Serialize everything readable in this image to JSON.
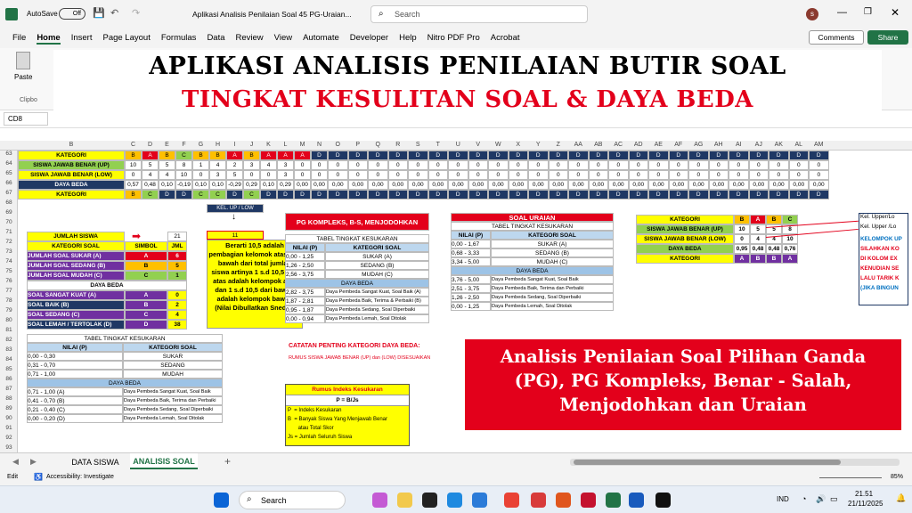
{
  "app": {
    "autosave": "AutoSave",
    "autosave_state": "Off",
    "title": "Aplikasi Analisis Penilaian Soal 45 PG-Uraian...",
    "search": "Search",
    "user_initial": "s"
  },
  "ribbon": {
    "tabs": [
      "File",
      "Home",
      "Insert",
      "Page Layout",
      "Formulas",
      "Data",
      "Review",
      "View",
      "Automate",
      "Developer",
      "Help",
      "Nitro PDF Pro",
      "Acrobat"
    ],
    "comments": "Comments",
    "share": "Share",
    "paste": "Paste",
    "clipboard": "Clipbo"
  },
  "namebox": "CD8",
  "overlay": {
    "line1": "APLIKASI ANALISIS PENILAIAN BUTIR SOAL",
    "line2": "TINGKAT KESULITAN SOAL & DAYA BEDA"
  },
  "columns": [
    "B",
    "C",
    "D",
    "E",
    "F",
    "G",
    "H",
    "I",
    "J",
    "K",
    "L",
    "M",
    "N",
    "O",
    "P",
    "Q",
    "R",
    "S",
    "T",
    "U",
    "V",
    "W",
    "X",
    "Y",
    "Z",
    "AA",
    "AB",
    "AC",
    "AD",
    "AE",
    "AF",
    "AG",
    "AH",
    "AI",
    "AJ",
    "AK",
    "AL",
    "AM"
  ],
  "rows": [
    "63",
    "64",
    "65",
    "66",
    "67",
    "68",
    "69",
    "70",
    "71",
    "72",
    "73",
    "74",
    "75",
    "76",
    "77",
    "78",
    "79",
    "80",
    "81",
    "82",
    "83",
    "84",
    "85",
    "86",
    "87",
    "88",
    "89",
    "90",
    "91",
    "92",
    "93"
  ],
  "toprows": {
    "r63": {
      "label": "KATEGORI",
      "vals": [
        "B",
        "A",
        "B",
        "C",
        "B",
        "B",
        "A",
        "B",
        "A",
        "A",
        "A"
      ]
    },
    "r64": {
      "label": "SISWA JAWAB BENAR (UP)",
      "vals": [
        "10",
        "5",
        "5",
        "8",
        "1",
        "4",
        "2",
        "3",
        "4",
        "3",
        "0"
      ]
    },
    "r65": {
      "label": "SISWA JAWAB BENAR (LOW)",
      "vals": [
        "0",
        "4",
        "4",
        "10",
        "0",
        "3",
        "5",
        "0",
        "0",
        "3",
        "0"
      ]
    },
    "r66": {
      "label": "DAYA BEDA",
      "vals": [
        "0,57",
        "0,48",
        "0,10",
        "-0,19",
        "0,10",
        "0,10",
        "-0,29",
        "0,29",
        "0,10",
        "0,29",
        "0,00"
      ]
    },
    "r67": {
      "label": "KATEGORI",
      "vals": [
        "B",
        "C",
        "D",
        "D",
        "C",
        "C",
        "D",
        "C",
        "D",
        "D",
        "D"
      ]
    },
    "zero": "0",
    "zero2": "0,00",
    "d": "D"
  },
  "kel": {
    "label": "KEL. UP / LOW",
    "value": "11"
  },
  "jumlah": {
    "label": "JUMLAH SISWA",
    "value": "21"
  },
  "katsoal": {
    "header": [
      "KATEGORI SOAL",
      "SIMBOL",
      "JML"
    ],
    "rows": [
      [
        "JUMLAH SOAL SUKAR (A)",
        "A",
        "6"
      ],
      [
        "JUMLAH SOAL SEDANG (B)",
        "B",
        "5"
      ],
      [
        "JUMLAH SOAL MUDAH (C)",
        "C",
        "1"
      ]
    ],
    "db_header": "DAYA BEDA",
    "db_rows": [
      [
        "SOAL SANGAT KUAT (A)",
        "A",
        "0"
      ],
      [
        "SOAL BAIK (B)",
        "B",
        "2"
      ],
      [
        "SOAL SEDANG (C)",
        "C",
        "4"
      ],
      [
        "SOAL LEMAH / TERTOLAK (D)",
        "D",
        "38"
      ]
    ]
  },
  "note": "Berarti 10,5 adalah pembagian kelomok atas dan bawah dari total jumlah siswa artinya 1 s.d 10,5 dari atas adalah kelompok atas dan 1 s.d 10,5 dari bawah adalah kelompok bawah (Nilai Dibullatkan Snediri)",
  "pgk": {
    "title": "PG KOMPLEKS, B-S, MENJODOHKAN",
    "tk_header": "TABEL TINGKAT KESUKARAN",
    "nilai": "NILAI (P)",
    "kat": "KATEGORI SOAL",
    "tk_rows": [
      [
        "0,00 - 1,25",
        "SUKAR (A)"
      ],
      [
        "1,26 - 2,50",
        "SEDANG (B)"
      ],
      [
        "2,56 - 3,75",
        "MUDAH (C)"
      ]
    ],
    "db": "DAYA BEDA",
    "db_rows": [
      [
        "2,82 - 3,75",
        "Daya Pembeda Sangat Kuat, Soal Baik (A)"
      ],
      [
        "1,87 - 2,81",
        "Daya Pembeda Baik, Terima & Perbaiki (B)"
      ],
      [
        "0,95 - 1,87",
        "Daya Pembeda Sedang, Soal Diperbaiki"
      ],
      [
        "0,00 - 0,94",
        "Daya Pembeda Lemah, Soal Ditolak"
      ]
    ]
  },
  "uraian": {
    "title": "SOAL URAIAN",
    "tk_header": "TABEL TINGKAT KESUKARAN",
    "nilai": "NILAI (P)",
    "kat": "KATEGORI SOAL",
    "tk_rows": [
      [
        "0,00 - 1,67",
        "SUKAR (A)"
      ],
      [
        "0,68 - 3,33",
        "SEDANG (B)"
      ],
      [
        "3,34 - 5,00",
        "MUDAH (C)"
      ]
    ],
    "db": "DAYA BEDA",
    "db_rows": [
      [
        "3,76 - 5,00",
        "Daya Pembeda Sangat Kuat, Soal Baik"
      ],
      [
        "2,51 - 3,75",
        "Daya Pembeda Baik, Terima dan Perbaiki"
      ],
      [
        "1,26 - 2,50",
        "Daya Pembeda Sedang, Soal Diperbaiki"
      ],
      [
        "0,00 - 1,25",
        "Daya Pembeda Lemah, Soal Ditolak"
      ]
    ]
  },
  "right": {
    "rows": [
      [
        "KATEGORI",
        "B",
        "A",
        "B",
        "C"
      ],
      [
        "SISWA JAWAB BENAR (UP)",
        "10",
        "5",
        "5",
        "8"
      ],
      [
        "SISWA JAWAB BENAR (LOW)",
        "0",
        "4",
        "4",
        "10"
      ],
      [
        "DAYA BEDA",
        "0,95",
        "0,48",
        "0,48",
        "0,76"
      ],
      [
        "KATEGORI",
        "A",
        "B",
        "B",
        "A"
      ]
    ],
    "side": [
      "Kel. Upper/Lo",
      "Kel. Upper /Lo",
      "KELOMPOK UP",
      "SILAHKAN KO",
      "DI KOLOM EX",
      "KENUDIAN SE",
      "LALU TARIK K",
      "(JIKA BINGUN"
    ]
  },
  "pg": {
    "tk_header": "TABEL TINGKAT KESUKARAN",
    "nilai": "NILAI (P)",
    "kat": "KATEGORI SOAL",
    "tk_rows": [
      [
        "0,00 - 0,30",
        "SUKAR"
      ],
      [
        "0,31 - 0,70",
        "SEDANG"
      ],
      [
        "0,71 - 1,00",
        "MUDAH"
      ]
    ],
    "db": "DAYA BEDA",
    "db_rows": [
      [
        "0,71 - 1,00 (A)",
        "Daya Pembeda Sangat Kuat, Soal Baik"
      ],
      [
        "0,41 - 0,70 (B)",
        "Daya Pembeda Baik, Terima dan Perbaiki"
      ],
      [
        "0,21 - 0,40 (C)",
        "Daya Pembeda Sedang, Soal Diperbaiki"
      ],
      [
        "0,00 - 0,20 (D)",
        "Daya Pembeda Lemah, Soal Ditolak"
      ]
    ]
  },
  "catatan": {
    "title": "CATATAN PENTING KATEGORI DAYA BEDA:",
    "text": "RUMUS SISWA JAWAB BENAR (UP) dan (LOW) DISESUAIKAN"
  },
  "rumus": {
    "title": "Rumus Indeks Kesukaran",
    "formula": "P = B/Js",
    "lines": [
      "P  = Indeks Kesukaran",
      "B  = Banyak Siswa Yang Menjawab Benar",
      "       atau Total Skor",
      "Js = Jumlah Seluruh Siswa"
    ]
  },
  "banner": "Analisis Penilaian Soal Pilihan Ganda (PG), PG Kompleks, Benar - Salah, Menjodohkan dan Uraian",
  "sheets": [
    "DATA SISWA",
    "ANALISIS SOAL"
  ],
  "status": {
    "mode": "Edit",
    "access": "Accessibility: Investigate",
    "zoom": "85%"
  },
  "taskbar": {
    "search": "Search",
    "lang": "IND",
    "time": "21.51",
    "date": "21/11/2025"
  },
  "colors": {
    "excel_green": "#217346",
    "red": "#e3001b",
    "yellow": "#ffff00",
    "navy": "#1f3864"
  }
}
